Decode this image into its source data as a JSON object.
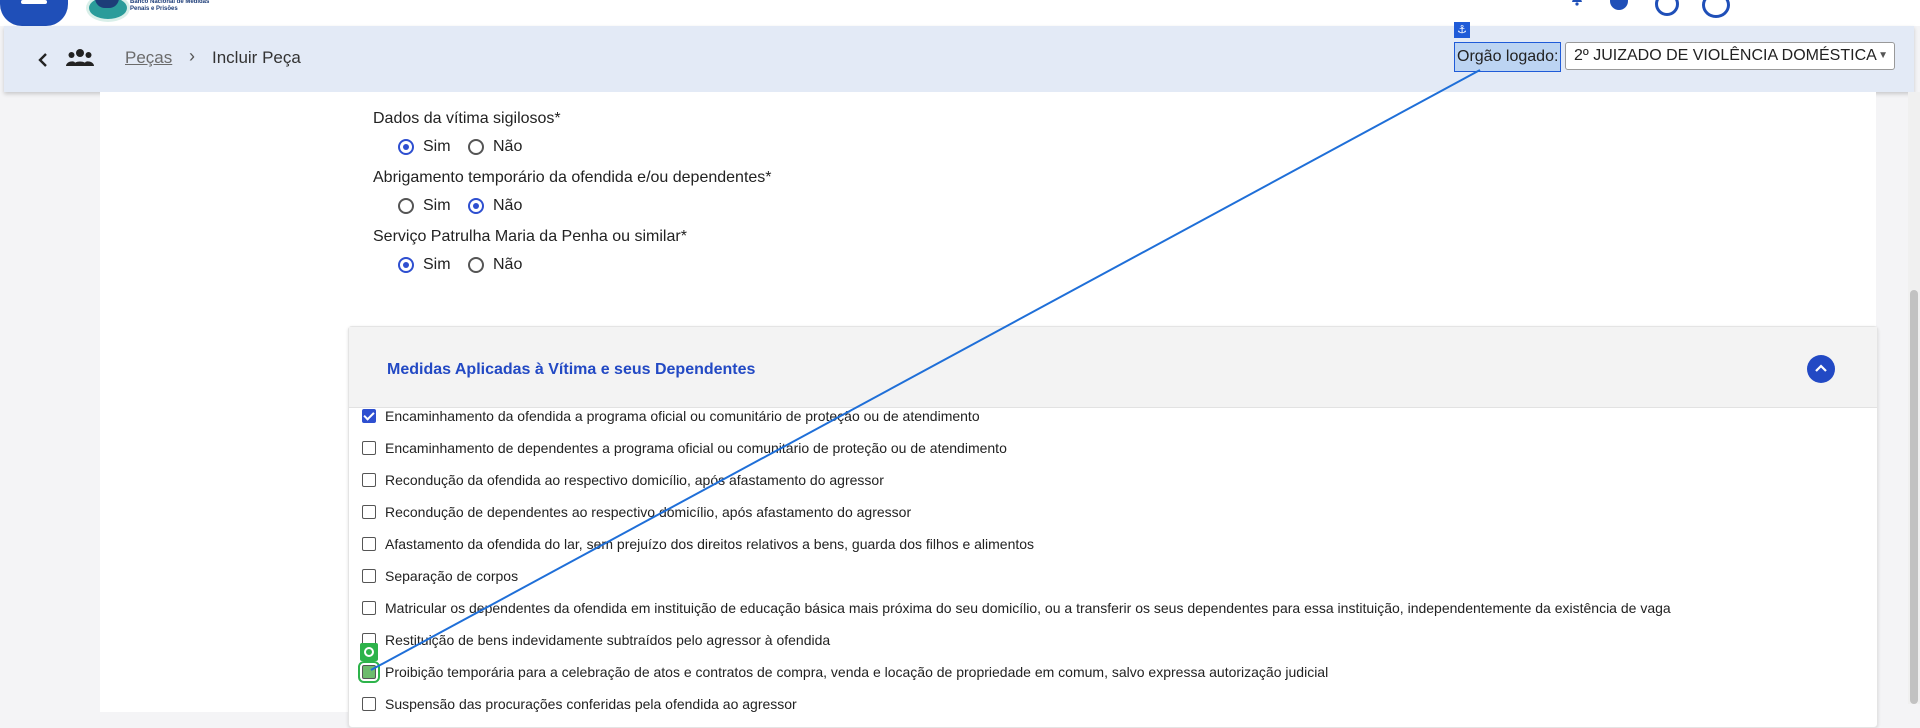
{
  "header": {
    "logo_text": "Banco Nacional de Medidas Penais e Prisões"
  },
  "breadcrumb": {
    "link": "Peças",
    "separator": "›",
    "current": "Incluir Peça"
  },
  "orgao": {
    "label": "Orgão logado:",
    "selected": "2º JUIZADO DE VIOLÊNCIA DOMÉSTICA",
    "anchor_glyph": "⚓"
  },
  "questions": [
    {
      "label": "Dados da vítima sigilosos*",
      "options": [
        "Sim",
        "Não"
      ],
      "selected": "Sim"
    },
    {
      "label": "Abrigamento tempоrário da ofendida e/ou dependentes*",
      "options": [
        "Sim",
        "Não"
      ],
      "selected": "Não"
    },
    {
      "label": "Serviço Patrulha Maria da Penha ou similar*",
      "options": [
        "Sim",
        "Não"
      ],
      "selected": "Sim"
    }
  ],
  "medidas": {
    "title": "Medidas Aplicadas à Vítima e seus Dependentes",
    "items": [
      {
        "label": "Encaminhamento da ofendida a programa oficial ou comunitário de proteção ou de atendimento",
        "checked": true
      },
      {
        "label": "Encaminhamento de dependentes a programa oficial ou comunitário de proteção ou de atendimento",
        "checked": false
      },
      {
        "label": "Recondução da ofendida ao respectivo domicílio, após afastamento do agressor",
        "checked": false
      },
      {
        "label": "Recondução de dependentes ao respectivo domicílio, após afastamento do agressor",
        "checked": false
      },
      {
        "label": "Afastamento da ofendida do lar, sem prejuízo dos direitos relativos a bens, guarda dos filhos e alimentos",
        "checked": false
      },
      {
        "label": "Separação de corpos",
        "checked": false
      },
      {
        "label": "Matricular os dependentes da ofendida em instituição de educação básica mais próxima do seu domicílio, ou a transferir os seus dependentes para essa instituição, independentemente da existência de vaga",
        "checked": false
      },
      {
        "label": "Restituição de bens indevidamente subtraídos pelo agressor à ofendida",
        "checked": false
      },
      {
        "label": "Proibição temporária para a celebração de atos e contratos de compra, venda e locação de propriedade em comum, salvo expressa autorização judicial",
        "checked": false
      },
      {
        "label": "Suspensão das procurações conferidas pela ofendida ao agressor",
        "checked": false
      }
    ]
  },
  "colors": {
    "accent": "#2249c4",
    "breadcrumb_bg": "#e3eaf6",
    "highlight": "#2db34a",
    "drag_line": "#1f6fd8"
  }
}
